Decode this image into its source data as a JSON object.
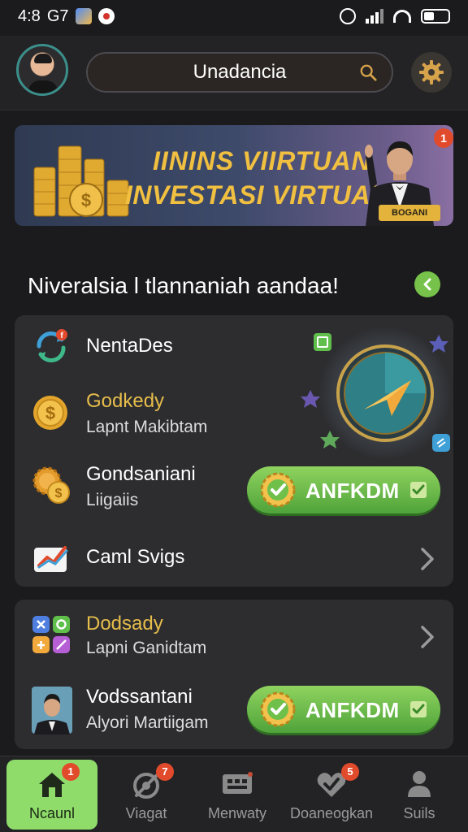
{
  "status_bar": {
    "time": "4:8",
    "carrier": "G7"
  },
  "header": {
    "search_value": "Unadancia"
  },
  "banner": {
    "line1": "IININS VIIRTUAN",
    "line2": "INVESTASI VIRTUAL",
    "tag": "BOGANI",
    "badge": "1"
  },
  "section": {
    "title": "Niveralsia l tlannaniah aandaa!"
  },
  "card1": {
    "rows": [
      {
        "title": "NentaDes",
        "icon": "refresh-icon"
      },
      {
        "title": "Godkedy",
        "subtitle": "Lapnt Makibtam",
        "icon": "gold-coin-icon"
      },
      {
        "title": "Gondsaniani",
        "subtitle": "Liigaiis",
        "icon": "coins-gear-icon",
        "button": "ANFKDM"
      },
      {
        "title": "Caml Svigs",
        "icon": "chart-icon"
      }
    ]
  },
  "card2": {
    "rows": [
      {
        "title": "Dodsady",
        "subtitle": "Lapni Ganidtam",
        "icon": "apps-icon"
      },
      {
        "title": "Vodssantani",
        "subtitle": "Alyori Martiigam",
        "icon": "profile-photo",
        "button": "ANFKDM"
      }
    ]
  },
  "bottom_nav": {
    "items": [
      {
        "label": "Ncaunl",
        "icon": "home-icon",
        "badge": "1",
        "active": true
      },
      {
        "label": "Viagat",
        "icon": "satellite-icon",
        "badge": "7"
      },
      {
        "label": "Menwaty",
        "icon": "chat-icon",
        "badge": ""
      },
      {
        "label": "Doaneogkan",
        "icon": "heart-check-icon",
        "badge": "5"
      },
      {
        "label": "Suils",
        "icon": "person-icon",
        "badge": ""
      }
    ]
  },
  "colors": {
    "accent_green": "#76c24a",
    "gold": "#e6bd4a",
    "badge_red": "#e24a2c"
  }
}
